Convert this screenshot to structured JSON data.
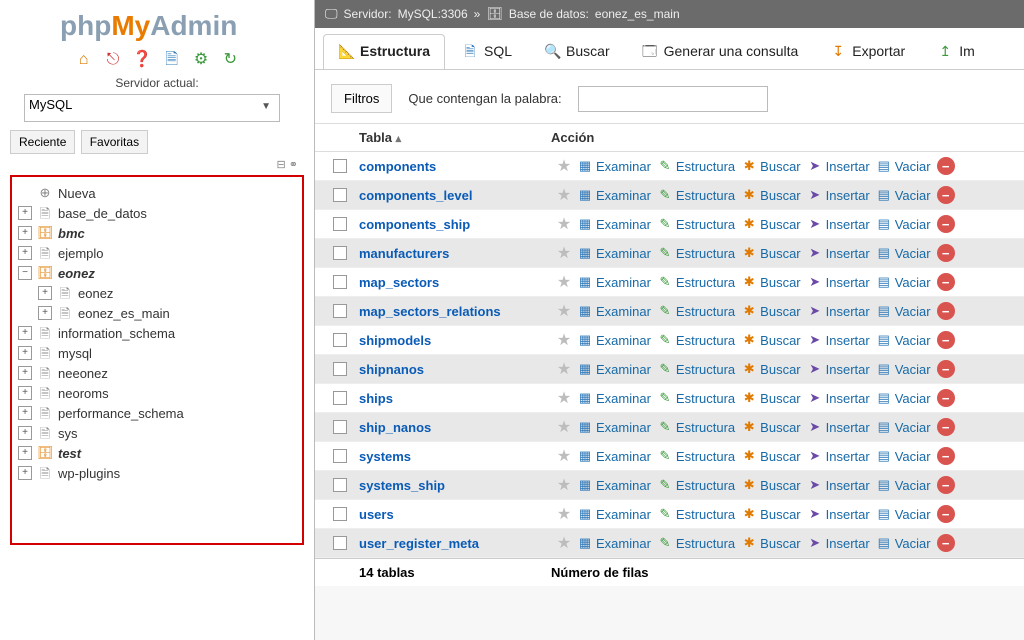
{
  "logo": {
    "p1": "php",
    "p2": "My",
    "p3": "Admin"
  },
  "sidebar": {
    "current_label": "Servidor actual:",
    "server_value": "MySQL",
    "recent": "Reciente",
    "favs": "Favoritas",
    "mini_sym": "⊟ ⚭",
    "nodes": [
      {
        "label": "Nueva",
        "icon": "⊕",
        "iconClass": "gray",
        "exp": null,
        "lvl": 0,
        "bold": false
      },
      {
        "label": "base_de_datos",
        "icon": "🗎",
        "iconClass": "gray",
        "exp": "+",
        "lvl": 0,
        "bold": false
      },
      {
        "label": "bmc",
        "icon": "🗄",
        "iconClass": "org",
        "exp": "+",
        "lvl": 0,
        "bold": true
      },
      {
        "label": "ejemplo",
        "icon": "🗎",
        "iconClass": "gray",
        "exp": "+",
        "lvl": 0,
        "bold": false
      },
      {
        "label": "eonez",
        "icon": "🗄",
        "iconClass": "org",
        "exp": "−",
        "lvl": 0,
        "bold": true
      },
      {
        "label": "eonez",
        "icon": "🗎",
        "iconClass": "gray",
        "exp": "+",
        "lvl": 1,
        "bold": false
      },
      {
        "label": "eonez_es_main",
        "icon": "🗎",
        "iconClass": "gray",
        "exp": "+",
        "lvl": 1,
        "bold": false
      },
      {
        "label": "information_schema",
        "icon": "🗎",
        "iconClass": "gray",
        "exp": "+",
        "lvl": 0,
        "bold": false
      },
      {
        "label": "mysql",
        "icon": "🗎",
        "iconClass": "gray",
        "exp": "+",
        "lvl": 0,
        "bold": false
      },
      {
        "label": "neeonez",
        "icon": "🗎",
        "iconClass": "gray",
        "exp": "+",
        "lvl": 0,
        "bold": false
      },
      {
        "label": "neoroms",
        "icon": "🗎",
        "iconClass": "gray",
        "exp": "+",
        "lvl": 0,
        "bold": false
      },
      {
        "label": "performance_schema",
        "icon": "🗎",
        "iconClass": "gray",
        "exp": "+",
        "lvl": 0,
        "bold": false
      },
      {
        "label": "sys",
        "icon": "🗎",
        "iconClass": "gray",
        "exp": "+",
        "lvl": 0,
        "bold": false
      },
      {
        "label": "test",
        "icon": "🗄",
        "iconClass": "org",
        "exp": "+",
        "lvl": 0,
        "bold": true
      },
      {
        "label": "wp-plugins",
        "icon": "🗎",
        "iconClass": "gray",
        "exp": "+",
        "lvl": 0,
        "bold": false
      }
    ]
  },
  "breadcrumb": {
    "server_prefix": "Servidor:",
    "server": " MySQL:3306",
    "sep": "»",
    "db_prefix": "Base de datos:",
    "db": " eonez_es_main"
  },
  "tabs": [
    {
      "icon": "📐",
      "icls": "blue",
      "label": "Estructura",
      "active": true
    },
    {
      "icon": "🗎",
      "icls": "blue",
      "label": "SQL",
      "active": false
    },
    {
      "icon": "🔍",
      "icls": "",
      "label": "Buscar",
      "active": false
    },
    {
      "icon": "🗔",
      "icls": "",
      "label": "Generar una consulta",
      "active": false
    },
    {
      "icon": "↧",
      "icls": "orange",
      "label": "Exportar",
      "active": false
    },
    {
      "icon": "↥",
      "icls": "green",
      "label": "Im",
      "active": false
    }
  ],
  "filter": {
    "chip": "Filtros",
    "label": "Que contengan la palabra:"
  },
  "headers": {
    "table": "Tabla",
    "sort": "▴",
    "action": "Acción"
  },
  "action_labels": {
    "exam": "Examinar",
    "str": "Estructura",
    "search": "Buscar",
    "ins": "Insertar",
    "empty": "Vaciar",
    "del": "−"
  },
  "action_icons": {
    "exam": "▦",
    "str": "✎",
    "search": "✱",
    "ins": "➤",
    "empty": "▤",
    "del": "−"
  },
  "tables": [
    "components",
    "components_level",
    "components_ship",
    "manufacturers",
    "map_sectors",
    "map_sectors_relations",
    "shipmodels",
    "shipnanos",
    "ships",
    "ship_nanos",
    "systems",
    "systems_ship",
    "users",
    "user_register_meta"
  ],
  "footer": {
    "count": "14 tablas",
    "rows": "Número de filas"
  }
}
